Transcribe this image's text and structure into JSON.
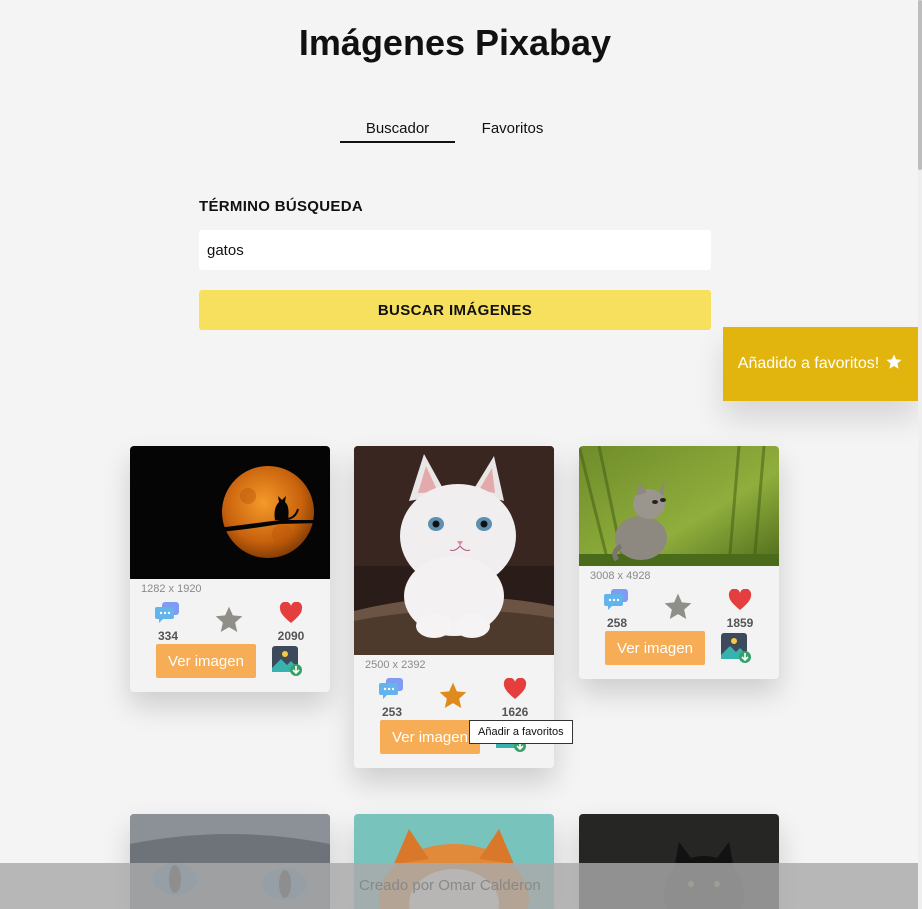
{
  "app": {
    "title": "Imágenes Pixabay"
  },
  "tabs": [
    {
      "label": "Buscador",
      "active": true
    },
    {
      "label": "Favoritos",
      "active": false
    }
  ],
  "search": {
    "label": "TÉRMINO BÚSQUEDA",
    "value": "gatos",
    "button_label": "BUSCAR IMÁGENES"
  },
  "toast": {
    "text": "Añadido a favoritos!",
    "icon": "star-icon",
    "color": "#e2b40e"
  },
  "cards": [
    {
      "dims": "1282 x 1920",
      "comments": "334",
      "likes": "2090",
      "favorited": false,
      "view_label": "Ver imagen",
      "photo": "cat silhouette against orange moon"
    },
    {
      "dims": "2500 x 2392",
      "comments": "253",
      "likes": "1626",
      "favorited": true,
      "view_label": "Ver imagen",
      "photo": "white kitten"
    },
    {
      "dims": "3008 x 4928",
      "comments": "258",
      "likes": "1859",
      "favorited": false,
      "view_label": "Ver imagen",
      "photo": "grey kitten on grass"
    }
  ],
  "tooltip": {
    "text": "Añadir a favoritos"
  },
  "footer": {
    "text": "Creado por Omar Calderon"
  },
  "colors": {
    "accent": "#f6e05e",
    "button": "#f6ad55",
    "favorite": "#e08a1e",
    "heart": "#e53e3e",
    "comment": "#63b3ed"
  }
}
